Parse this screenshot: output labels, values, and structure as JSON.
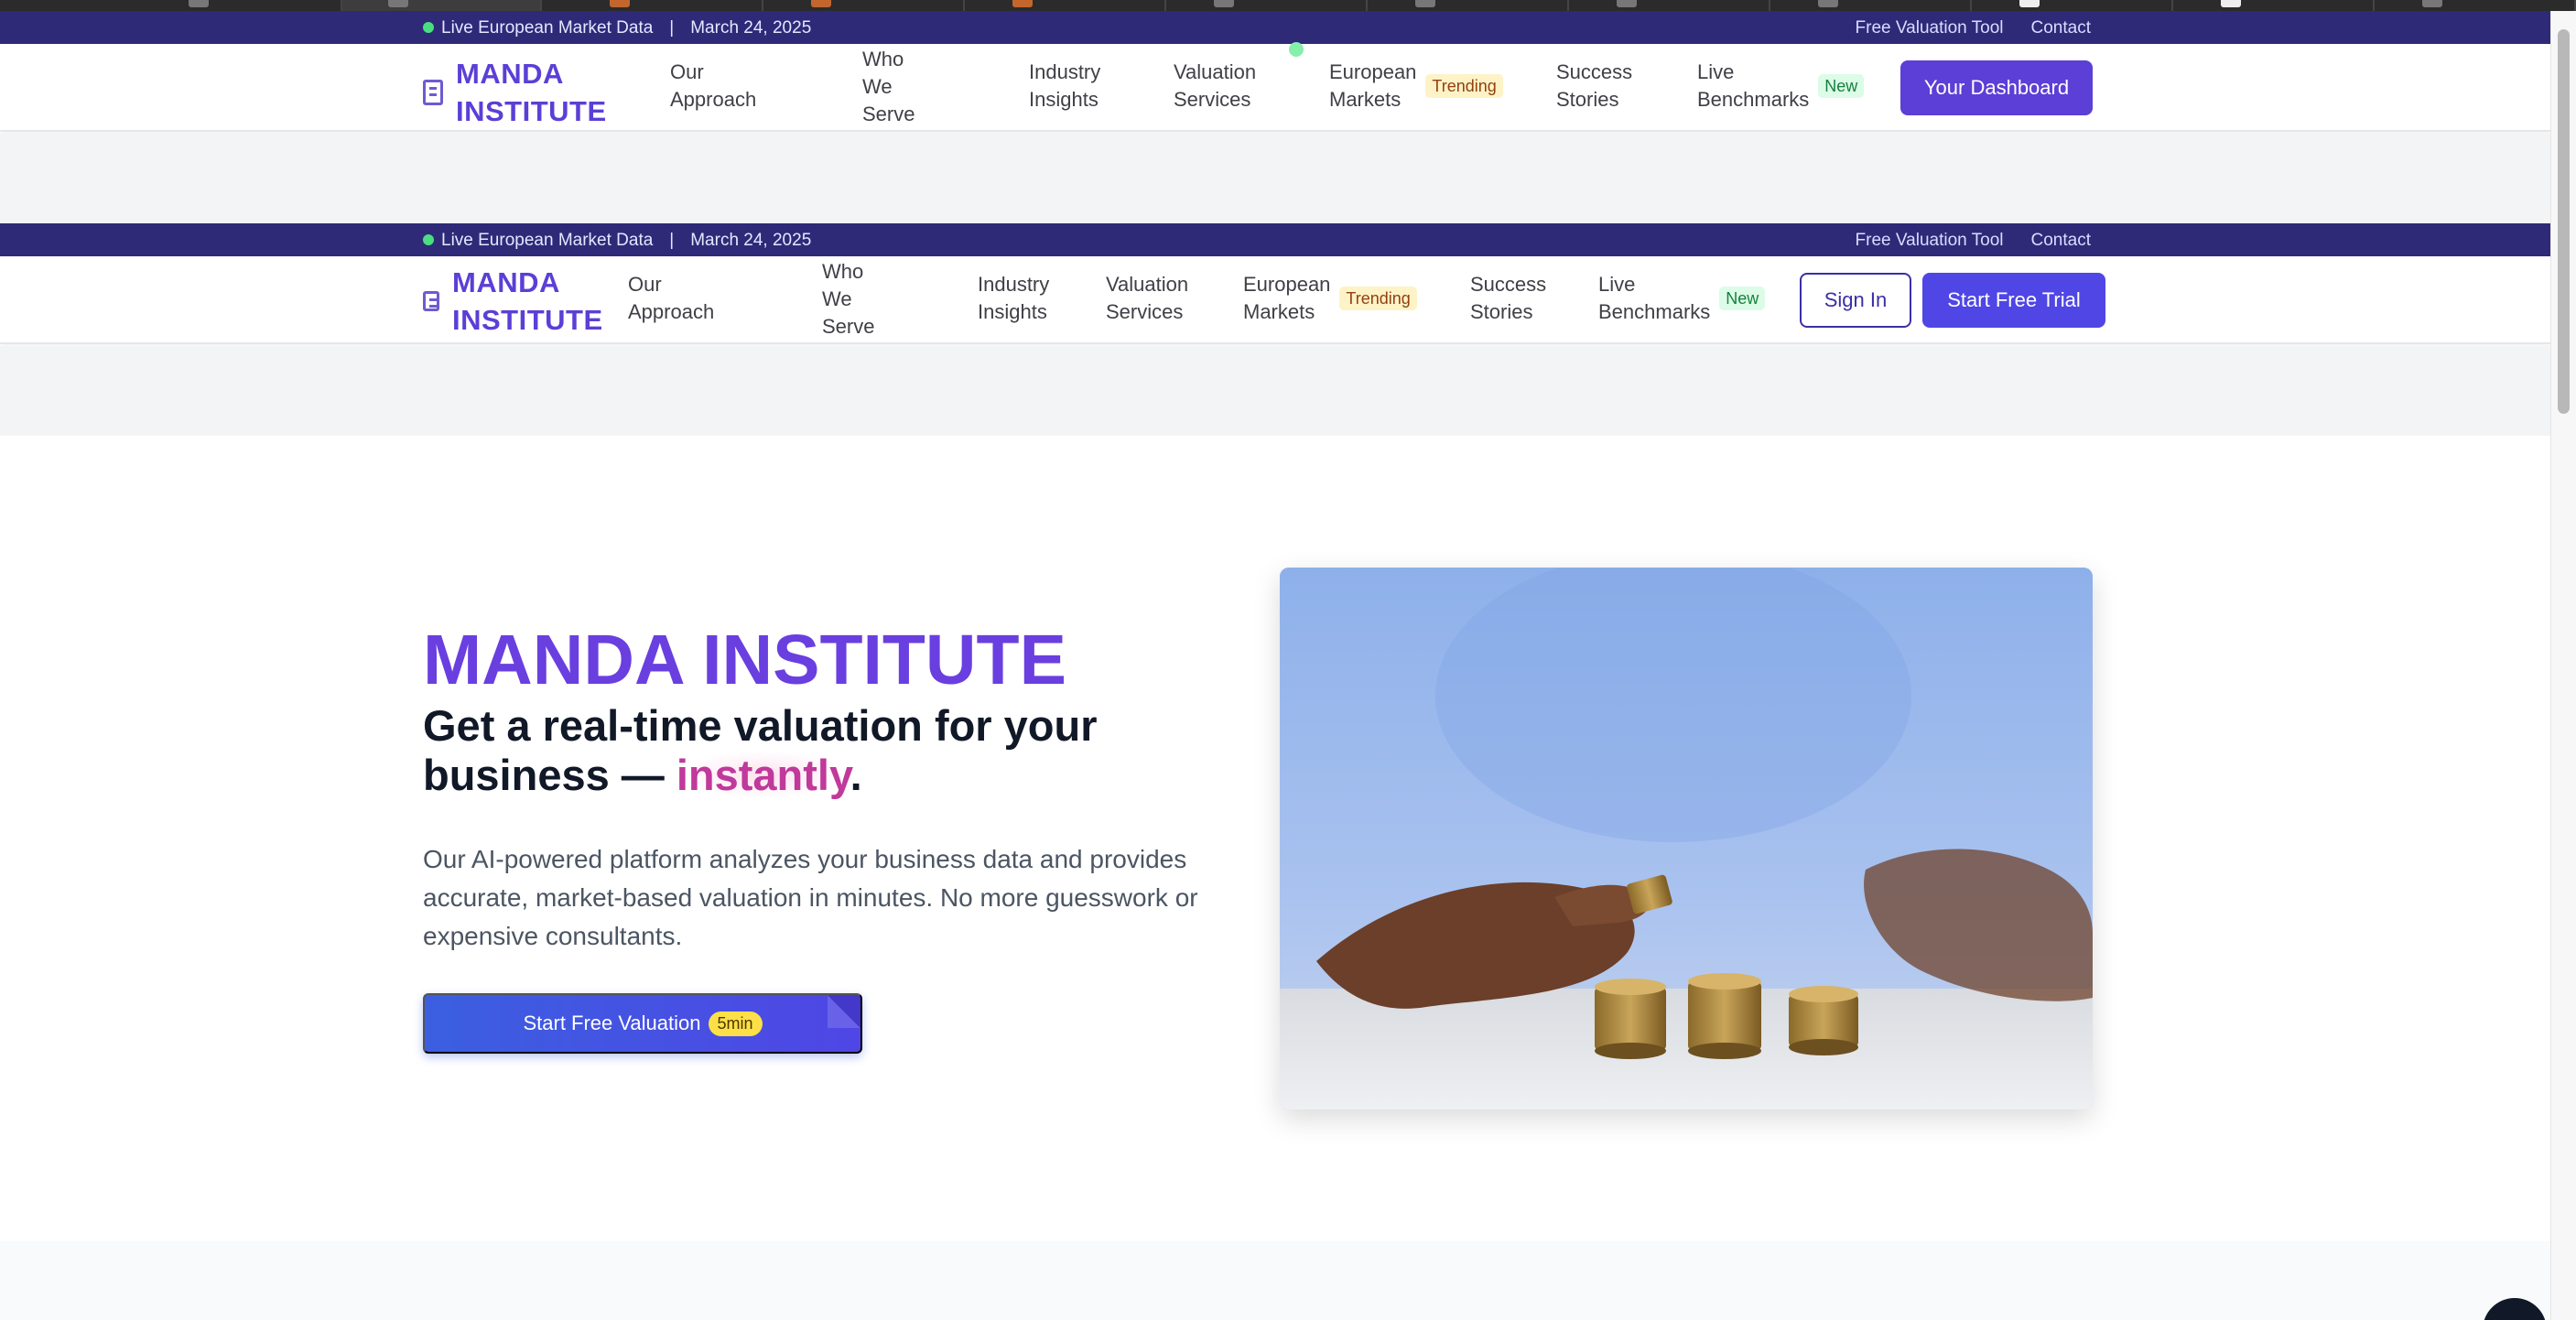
{
  "infobar": {
    "live_label": "Live European Market Data",
    "separator": "|",
    "date": "March 24, 2025",
    "links": [
      "Free Valuation Tool",
      "Contact"
    ]
  },
  "brand": {
    "line1": "MANDA",
    "line2": "INSTITUTE"
  },
  "nav": {
    "our_approach": [
      "Our",
      "Approach"
    ],
    "who_we_serve": [
      "Who",
      "We",
      "Serve"
    ],
    "industry_insights": [
      "Industry",
      "Insights"
    ],
    "valuation_services": [
      "Valuation",
      "Services"
    ],
    "european_markets": [
      "European",
      "Markets"
    ],
    "trending_badge": "Trending",
    "success_stories": [
      "Success",
      "Stories"
    ],
    "live_benchmarks": [
      "Live",
      "Benchmarks"
    ],
    "new_badge": "New"
  },
  "header_a": {
    "dashboard_button": "Your Dashboard"
  },
  "header_b": {
    "sign_in_button": "Sign In",
    "trial_button": "Start Free Trial"
  },
  "hero": {
    "title": "MANDA INSTITUTE",
    "subtitle_before": "Get a real-time valuation for your business — ",
    "subtitle_accent": "instantly",
    "subtitle_after": ".",
    "description": "Our AI-powered platform analyzes your business data and provides accurate, market-based valuation in minutes. No more guesswork or expensive consultants.",
    "cta_label": "Start Free Valuation",
    "cta_badge": "5min"
  },
  "colors": {
    "brand_purple": "#5b3fd6",
    "infobar_navy": "#2e2a78",
    "live_green": "#4ade80",
    "accent_pink": "#c0399b"
  },
  "icons": {
    "logo": "building-icon",
    "live_indicator": "live-dot-icon"
  }
}
